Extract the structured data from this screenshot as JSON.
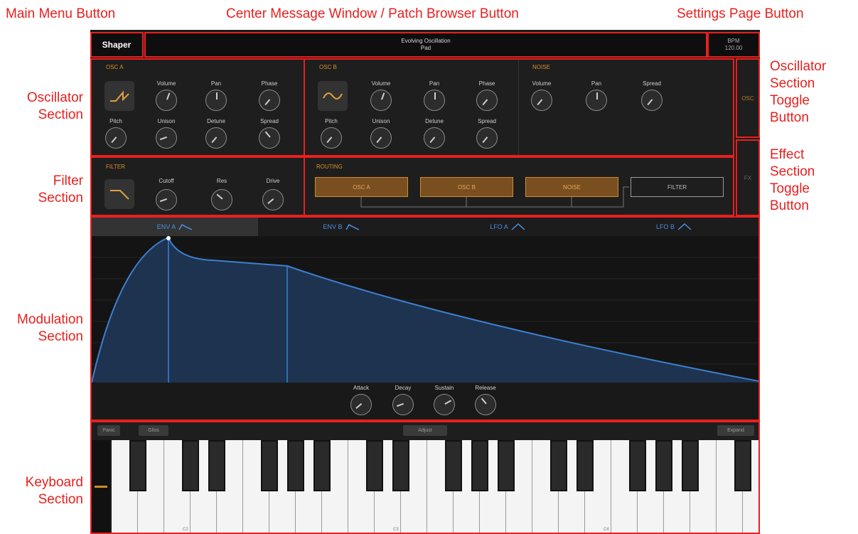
{
  "annotations": {
    "main_menu": "Main Menu Button",
    "center": "Center Message Window / Patch Browser Button",
    "settings": "Settings Page Button",
    "oscillator_section": [
      "Oscillator",
      "Section"
    ],
    "filter_section": [
      "Filter",
      "Section"
    ],
    "modulation_section": [
      "Modulation",
      "Section"
    ],
    "keyboard_section": [
      "Keyboard",
      "Section"
    ],
    "osc_toggle": [
      "Oscillator",
      "Section",
      "Toggle",
      "Button"
    ],
    "fx_toggle": [
      "Effect",
      "Section",
      "Toggle",
      "Button"
    ]
  },
  "topbar": {
    "menu_label": "Shaper",
    "patch_name": "Evolving Oscillation",
    "patch_category": "Pad",
    "bpm_label": "BPM",
    "bpm_value": "120.00"
  },
  "osc_a": {
    "title": "OSC A",
    "knobs_row1": [
      "Volume",
      "Pan",
      "Phase"
    ],
    "knobs_row2": [
      "Pitch",
      "Unison",
      "Detune",
      "Spread"
    ]
  },
  "osc_b": {
    "title": "OSC B",
    "knobs_row1": [
      "Volume",
      "Pan",
      "Phase"
    ],
    "knobs_row2": [
      "Pitch",
      "Unison",
      "Detune",
      "Spread"
    ]
  },
  "noise": {
    "title": "NOISE",
    "knobs": [
      "Volume",
      "Pan",
      "Spread"
    ]
  },
  "side": {
    "osc": "OSC",
    "fx": "FX"
  },
  "filter": {
    "title": "FILTER",
    "knobs": [
      "Cutoff",
      "Res",
      "Drive"
    ]
  },
  "routing": {
    "title": "ROUTING",
    "sources": [
      "OSC A",
      "OSC B",
      "NOISE"
    ],
    "destination": "FILTER"
  },
  "modulation": {
    "tabs": [
      "ENV A",
      "ENV B",
      "LFO A",
      "LFO B"
    ],
    "active_tab": "ENV A",
    "knobs": [
      "Attack",
      "Decay",
      "Sustain",
      "Release"
    ],
    "accent_color": "#4a90e2"
  },
  "keyboard": {
    "buttons_left": [
      "Panic",
      "Gliss"
    ],
    "button_center": "Adjust",
    "button_right": "Expand",
    "note_labels": [
      "C2",
      "C3",
      "C4"
    ]
  }
}
